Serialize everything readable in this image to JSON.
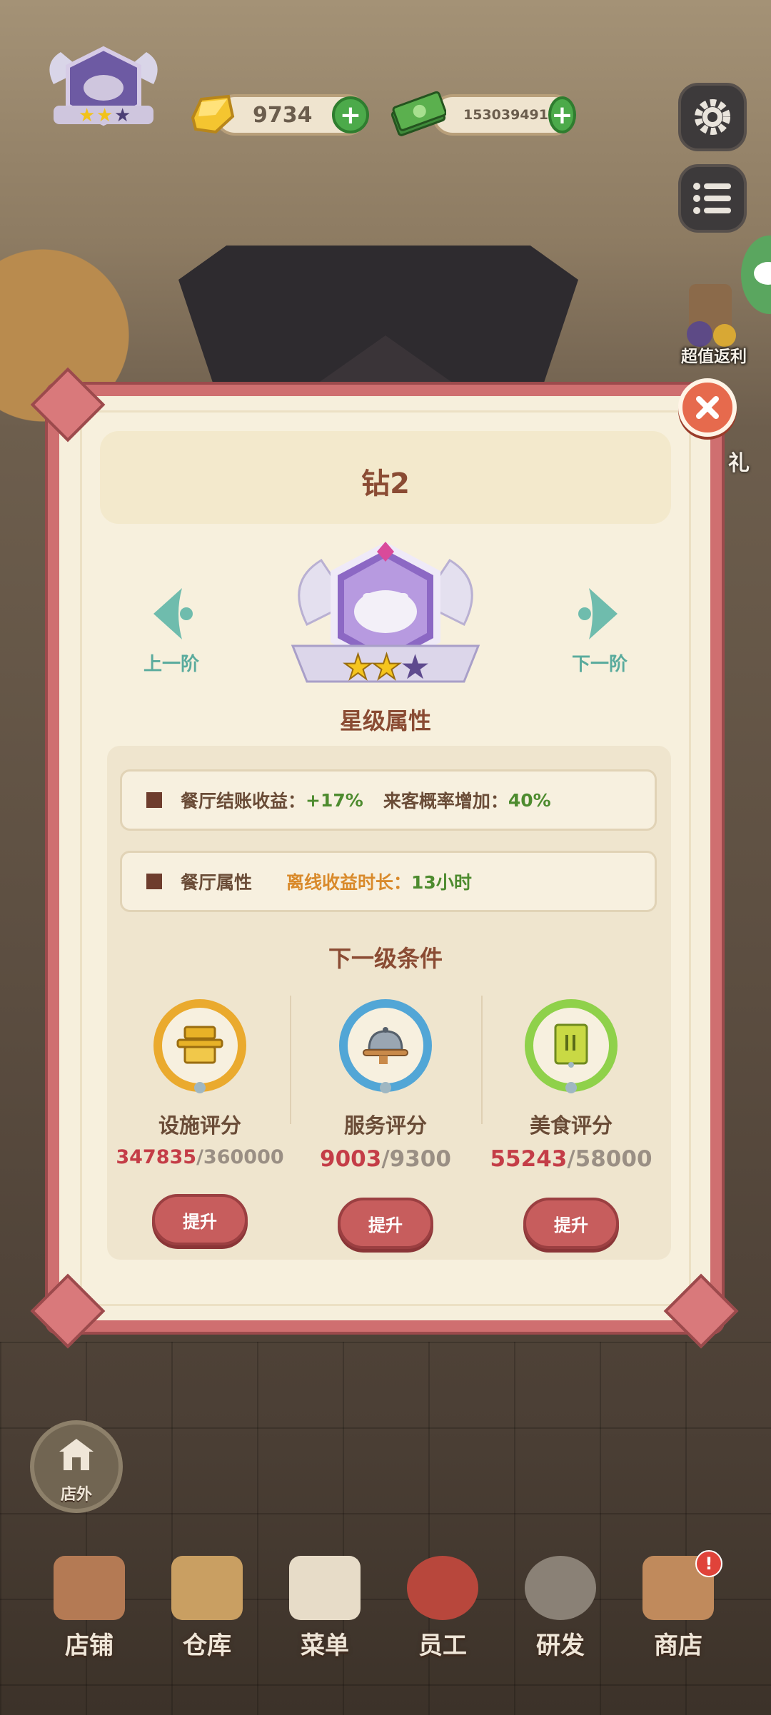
{
  "hud": {
    "gold_value": "9734",
    "cash_value": "153039491",
    "plus_label": "+",
    "promo_label": "超值返利",
    "promo_label_2": "礼"
  },
  "modal": {
    "title": "钻2",
    "prev_label": "上一阶",
    "next_label": "下一阶",
    "attributes_heading": "星级属性",
    "attribute_rows": [
      {
        "label": "餐厅结账收益：",
        "value": "+17%",
        "label2": "来客概率增加：",
        "value2": "40%"
      },
      {
        "label": "餐厅属性",
        "value_label": "离线收益时长：",
        "value": "13小时"
      }
    ],
    "conditions_heading": "下一级条件",
    "conditions": [
      {
        "label": "设施评分",
        "current": "347835",
        "total": "/360000",
        "button": "提升"
      },
      {
        "label": "服务评分",
        "current": "9003",
        "total": "/9300",
        "button": "提升"
      },
      {
        "label": "美食评分",
        "current": "55243",
        "total": "/58000",
        "button": "提升"
      }
    ],
    "badge_stars_filled": 2,
    "badge_stars_total": 3
  },
  "outside_button": "店外",
  "nav": [
    {
      "label": "店铺",
      "icon": "shop-icon"
    },
    {
      "label": "仓库",
      "icon": "warehouse-icon"
    },
    {
      "label": "菜单",
      "icon": "menu-clipboard-icon"
    },
    {
      "label": "员工",
      "icon": "staff-icon"
    },
    {
      "label": "研发",
      "icon": "cooking-pot-icon"
    },
    {
      "label": "商店",
      "icon": "store-icon"
    }
  ],
  "nav_badge": "!",
  "colors": {
    "modal_frame": "#cf6f70",
    "accent_green": "#4d8b2e",
    "accent_orange": "#d98a2b",
    "progress_current": "#c43d47",
    "button_red": "#c75d5d"
  }
}
